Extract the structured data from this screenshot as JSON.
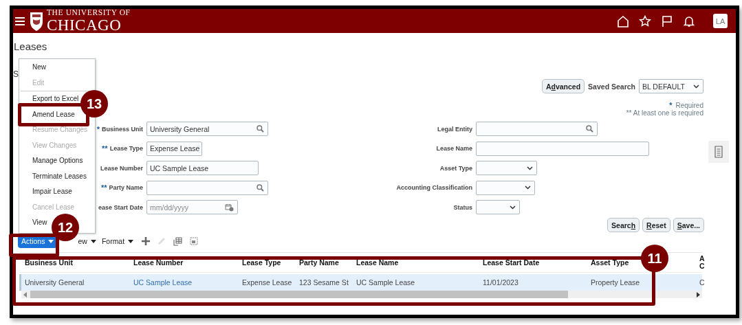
{
  "header": {
    "logo_top": "THE UNIVERSITY OF",
    "logo_bottom": "CHICAGO",
    "avatar": "LA"
  },
  "page_title": "Leases",
  "section_title": "S",
  "search": {
    "advanced": {
      "before": "A",
      "access_key": "d",
      "after": "vanced"
    },
    "saved_search_label": "Saved Search",
    "saved_search_value": "BL DEFAULT",
    "required_mark": "*",
    "required_note": "Required",
    "at_least_one_note": "** At least one is required",
    "left_fields": [
      {
        "marker": "*",
        "label": "Business Unit",
        "kind": "lookup",
        "value": "University General"
      },
      {
        "marker": "**",
        "label": "Lease Type",
        "kind": "select",
        "value": "Expense Lease"
      },
      {
        "label": "Lease Number",
        "kind": "text",
        "value": "UC Sample Lease"
      },
      {
        "marker": "**",
        "label": "Party Name",
        "kind": "lookup"
      },
      {
        "label": "ease Start Date",
        "kind": "date",
        "placeholder": "mm/dd/yyyy"
      }
    ],
    "right_fields": [
      {
        "label": "Legal Entity",
        "kind": "lookup"
      },
      {
        "label": "Lease Name",
        "kind": "text"
      },
      {
        "label": "Asset Type",
        "kind": "select"
      },
      {
        "label": "Accounting Classification",
        "kind": "select"
      },
      {
        "label": "Status",
        "kind": "select"
      }
    ],
    "buttons": [
      {
        "before": "Searc",
        "access_key": "h"
      },
      {
        "access_key": "R",
        "after": "eset"
      },
      {
        "access_key": "S",
        "after": "ave..."
      }
    ]
  },
  "actions_menu": {
    "items": [
      {
        "label": "New",
        "disabled": false,
        "divider_after": false
      },
      {
        "label": "Edit",
        "disabled": true,
        "divider_after": true
      },
      {
        "label": "Export to Excel",
        "disabled": false,
        "divider_after": false
      },
      {
        "label": "Amend Lease",
        "disabled": false,
        "divider_after": false
      },
      {
        "label": "Resume Changes",
        "disabled": true,
        "divider_after": false
      },
      {
        "label": "View Changes",
        "disabled": true,
        "divider_after": false
      },
      {
        "label": "Manage Options",
        "disabled": false,
        "divider_after": false
      },
      {
        "label": "Terminate Leases",
        "disabled": false,
        "divider_after": false
      },
      {
        "label": "Impair Lease",
        "disabled": false,
        "divider_after": false
      },
      {
        "label": "Cancel Lease",
        "disabled": true,
        "divider_after": false
      },
      {
        "label": "View",
        "disabled": false,
        "divider_after": false
      }
    ]
  },
  "toolbar": {
    "actions": "Actions",
    "view": "ew",
    "format": "Format"
  },
  "table": {
    "columns": [
      {
        "label": "Business Unit",
        "link": false
      },
      {
        "label": "Lease Number",
        "link": true
      },
      {
        "label": "Lease Type",
        "link": false
      },
      {
        "label": "Party Name",
        "link": false
      },
      {
        "label": "Lease Name",
        "link": false
      },
      {
        "label": "Lease Start Date",
        "link": false
      },
      {
        "label": "Asset Type",
        "link": false
      },
      {
        "label": "A C",
        "link": false
      }
    ],
    "rows": [
      {
        "selected": true,
        "cells": [
          "University General",
          "UC Sample Lease",
          "Expense Lease",
          "123 Sesame St",
          "UC Sample Lease",
          "11/01/2023",
          "Property Lease",
          "C"
        ]
      }
    ]
  },
  "callouts": [
    {
      "number": "13"
    },
    {
      "number": "12"
    },
    {
      "number": "11"
    }
  ]
}
